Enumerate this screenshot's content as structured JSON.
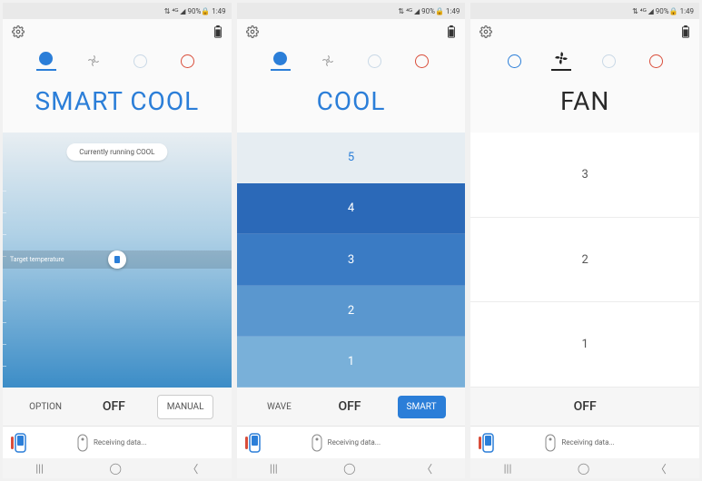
{
  "statusbar": {
    "signal": "⇅ ⁴ᴳ ◢ 90%🔒 1:49"
  },
  "screens": [
    {
      "title": "SMART COOL",
      "titleColor": "blue",
      "activeMode": 0,
      "pill": "Currently running COOL",
      "sliderLabel": "Target temperature",
      "buttons": {
        "left": "OPTION",
        "mid": "OFF",
        "right": "MANUAL",
        "rightStyle": "outline"
      }
    },
    {
      "title": "COOL",
      "titleColor": "blue",
      "activeMode": 0,
      "levels": [
        "5",
        "4",
        "3",
        "2",
        "1"
      ],
      "buttons": {
        "left": "WAVE",
        "mid": "OFF",
        "right": "SMART",
        "rightStyle": "primary"
      }
    },
    {
      "title": "FAN",
      "titleColor": "dark",
      "activeMode": 1,
      "levels": [
        "3",
        "2",
        "1"
      ],
      "buttons": {
        "left": "",
        "mid": "OFF",
        "right": ""
      }
    }
  ],
  "statusRow": {
    "text": "Receiving data..."
  },
  "colors": {
    "accent": "#2b7ed8",
    "red": "#d94d3a",
    "light": "#c9d8e6"
  },
  "coolGradient": [
    "#e6edf2",
    "#2b69b8",
    "#3a7bc4",
    "#5a97cf",
    "#79b0d9",
    "#9ac8e3"
  ]
}
